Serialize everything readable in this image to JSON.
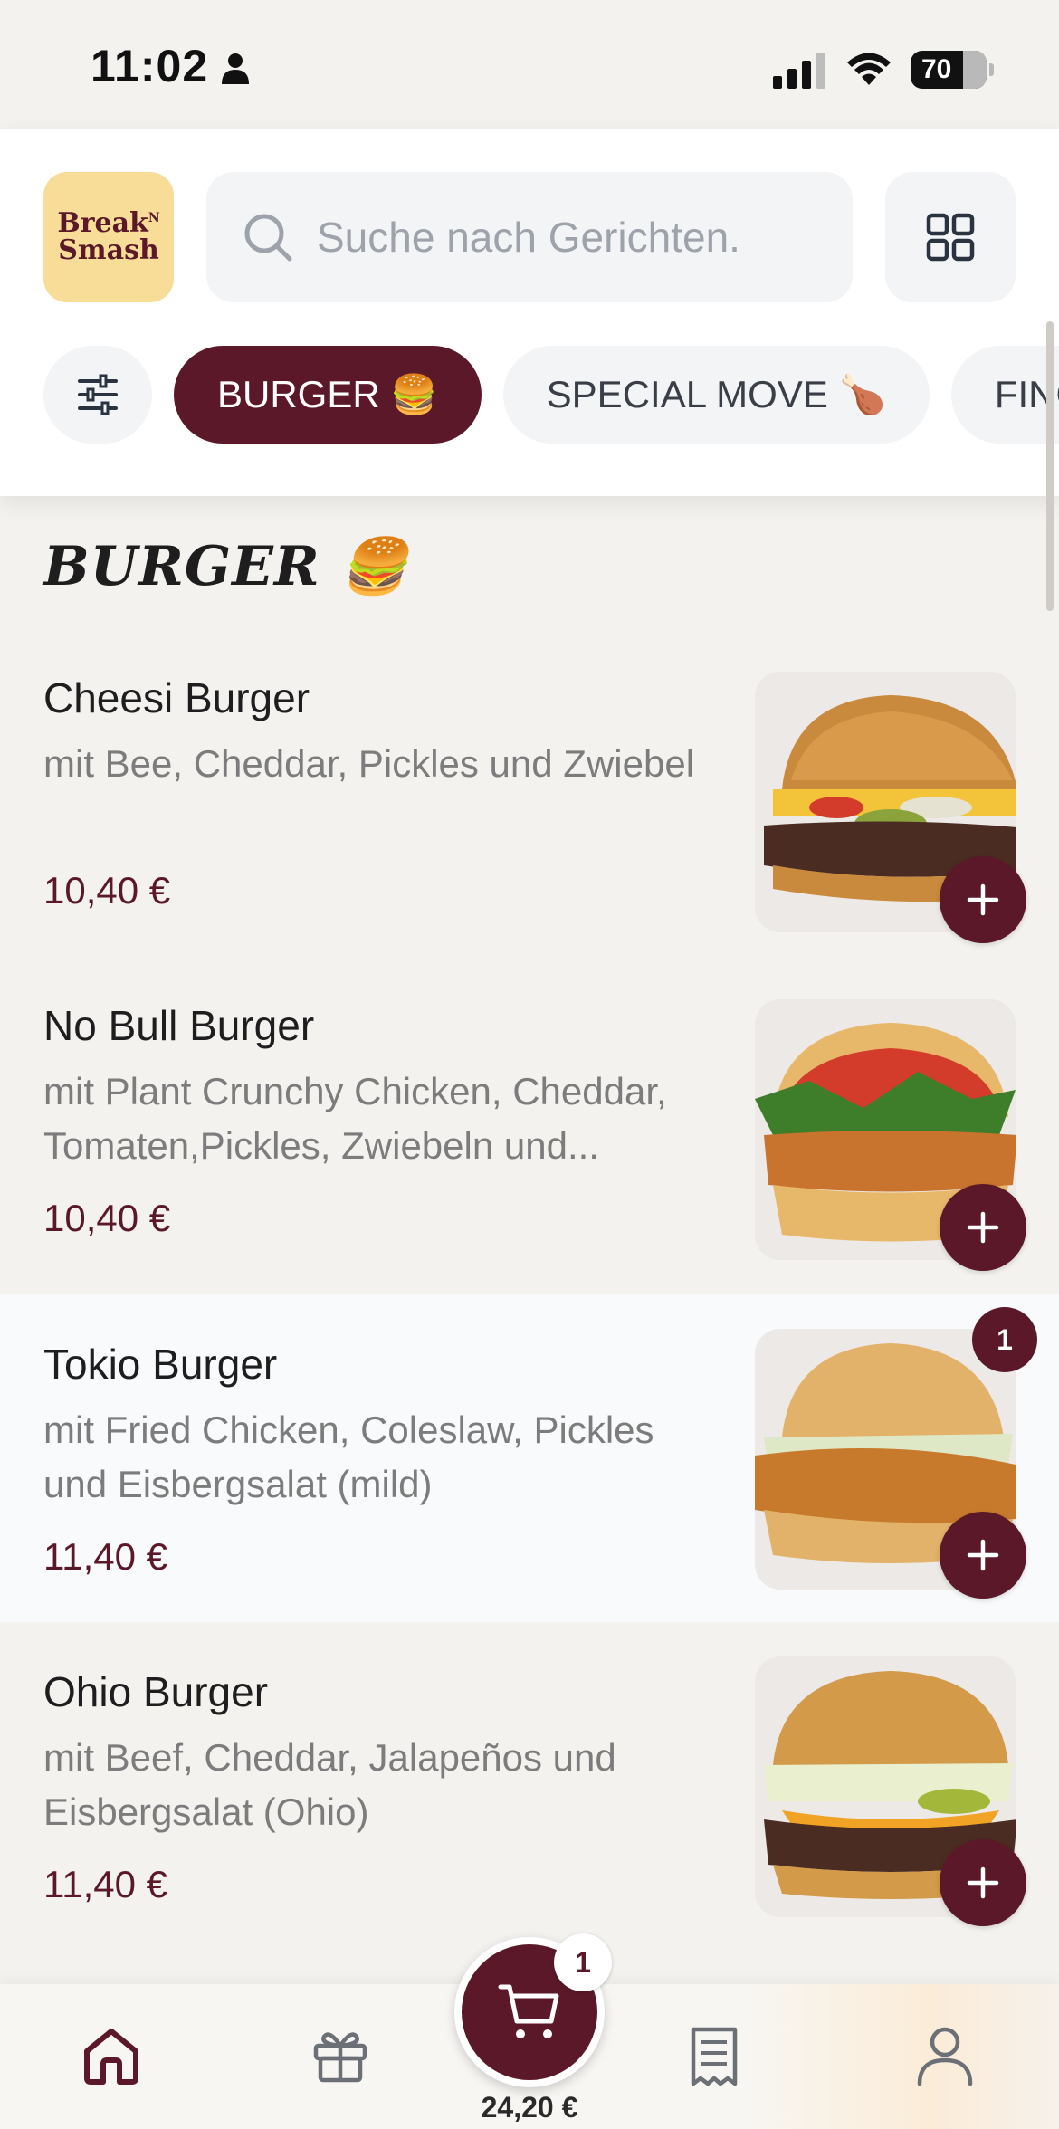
{
  "status_bar": {
    "time": "11:02",
    "battery": "70"
  },
  "header": {
    "logo": {
      "line1": "Break",
      "superscript": "N",
      "line2": "Smash"
    },
    "search": {
      "placeholder": "Suche nach Gerichten."
    },
    "chips": [
      {
        "label": "BURGER 🍔",
        "active": true
      },
      {
        "label": "SPECIAL MOVE 🍗",
        "active": false
      },
      {
        "label": "FINGER FOOD",
        "active": false
      }
    ]
  },
  "section": {
    "title": "BURGER 🍔"
  },
  "items": [
    {
      "name": "Cheesi Burger",
      "description": "mit Bee, Cheddar, Pickles und Zwiebel",
      "price": "10,40 €"
    },
    {
      "name": "No Bull Burger",
      "description": "mit Plant Crunchy Chicken, Cheddar, Tomaten,Pickles, Zwiebeln und...",
      "price": "10,40 €"
    },
    {
      "name": "Tokio Burger",
      "description": "mit Fried Chicken, Coleslaw, Pickles und Eisbergsalat (mild)",
      "price": "11,40 €",
      "quantity": "1"
    },
    {
      "name": "Ohio Burger",
      "description": "mit Beef, Cheddar, Jalapeños und Eisbergsalat (Ohio)",
      "price": "11,40 €"
    }
  ],
  "cart": {
    "count": "1",
    "total": "24,20 €"
  },
  "nav": {
    "items": [
      "home-icon",
      "gift-icon",
      "cart-icon",
      "receipt-icon",
      "user-icon"
    ]
  },
  "colors": {
    "brand": "#5b1828",
    "logo_bg": "#f8dd98",
    "background": "#f4f2ef"
  }
}
